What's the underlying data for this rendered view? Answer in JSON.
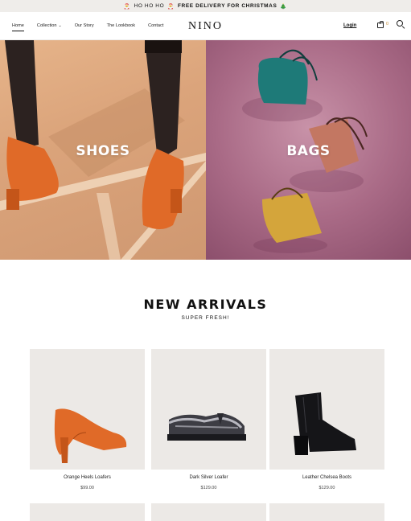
{
  "announcement": {
    "emoji_left": "🎅",
    "text_regular": "HO HO HO",
    "emoji_mid": "🎅",
    "text_bold": "FREE DELIVERY FOR CHRISTMAS",
    "emoji_right": "🎄"
  },
  "header": {
    "nav": [
      {
        "label": "Home",
        "active": true
      },
      {
        "label": "Collection",
        "has_dropdown": true
      },
      {
        "label": "Our Story"
      },
      {
        "label": "The Lookbook"
      },
      {
        "label": "Contact"
      }
    ],
    "logo": "NINO",
    "login_label": "Login",
    "cart_count": "0",
    "cart_icon": "shopping-bag-icon",
    "search_icon": "search-icon",
    "accent_color": "#c8913b"
  },
  "hero": {
    "shoes_label": "SHOES",
    "bags_label": "BAGS"
  },
  "new_arrivals": {
    "title": "NEW ARRIVALS",
    "subtitle": "SUPER FRESH!"
  },
  "products": [
    {
      "name": "Orange Heels Loafers",
      "price": "$99.00"
    },
    {
      "name": "Dark Silver Loafer",
      "price": "$129.00"
    },
    {
      "name": "Leather Chelsea Boots",
      "price": "$129.00"
    }
  ]
}
